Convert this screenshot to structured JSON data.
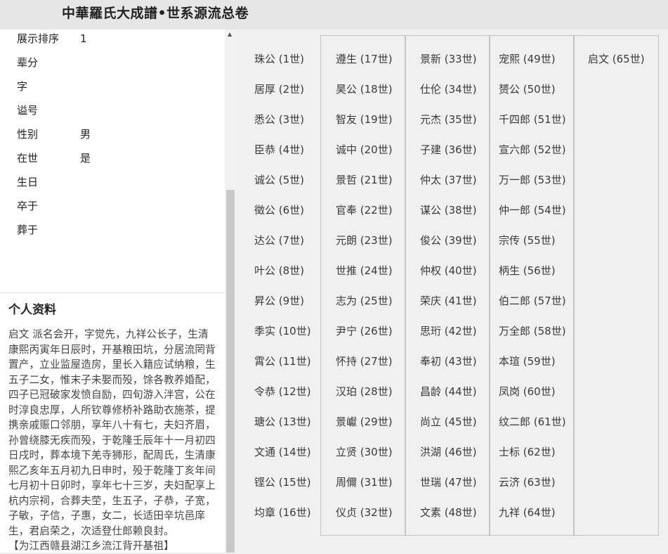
{
  "header": {
    "title": "中華羅氏大成譜•世系源流总卷"
  },
  "profile": {
    "rows": [
      {
        "label": "展示排序",
        "value": "1"
      },
      {
        "label": "辈分",
        "value": ""
      },
      {
        "label": "字",
        "value": ""
      },
      {
        "label": "谥号",
        "value": ""
      },
      {
        "label": "性别",
        "value": "男"
      },
      {
        "label": "在世",
        "value": "是"
      },
      {
        "label": "生日",
        "value": ""
      },
      {
        "label": "卒于",
        "value": ""
      },
      {
        "label": "葬于",
        "value": ""
      }
    ],
    "section_title": "个人资料",
    "bio": "启文 派名会开，字觉先，九祥公长子，生清康熙丙寅年日辰时，开基粮田坑，分居流罔背置产，立业监屋造房，里长入籍应试纳粮，生五子二女，惟末子未娶而殁，馀各教养婚配，四子已冠破家发愤自励，四旬游入泮宫，公在时淳良忠厚，人所钦尊修桥补路助衣施茶，提携亲戚赈口邻朋，享年八十有七，夫妇齐眉，孙曾绕膝无疾而殁，于乾隆壬辰年十一月初四日戌时，葬本境下羌寺狮形，配周氏，生清康熙乙亥年五月初九日申时，殁于乾隆丁亥年间七月初十日卯时，享年七十三岁，夫妇配享上杭内宗祠，合葬夫茔，生五子，子恭，子宽，子敏，子信，子惠，女二，长适田辛坑邑庠生，君启荣之，次适登仕郎赖良封。",
    "bio_last": "【为江西赣县湖江乡流江背开基祖】"
  },
  "generations": [
    "珠公 (1世)",
    "居厚 (2世)",
    "悉公 (3世)",
    "臣恭 (4世)",
    "诚公 (5世)",
    "徵公 (6世)",
    "达公 (7世)",
    "叶公 (8世)",
    "昇公 (9世)",
    "季实 (10世)",
    "霄公 (11世)",
    "令恭 (12世)",
    "瑭公 (13世)",
    "文通 (14世)",
    "铿公 (15世)",
    "均章 (16世)",
    "遵生 (17世)",
    "昊公 (18世)",
    "智友 (19世)",
    "诚中 (20世)",
    "景哲 (21世)",
    "官奉 (22世)",
    "元朗 (23世)",
    "世推 (24世)",
    "志为 (25世)",
    "尹宁 (26世)",
    "怀持 (27世)",
    "汉珀 (28世)",
    "景巘 (29世)",
    "立贤 (30世)",
    "周儞 (31世)",
    "仪贞 (32世)",
    "景新 (33世)",
    "仕伦 (34世)",
    "元杰 (35世)",
    "子建 (36世)",
    "仲太 (37世)",
    "谋公 (38世)",
    "俊公 (39世)",
    "仲权 (40世)",
    "荣庆 (41世)",
    "思珩 (42世)",
    "奉初 (43世)",
    "昌龄 (44世)",
    "尚立 (45世)",
    "洪湖 (46世)",
    "世瑞 (47世)",
    "文素 (48世)",
    "宠熙 (49世)",
    "赟公 (50世)",
    "千四郎 (51世)",
    "宣六郎 (52世)",
    "万一郎 (53世)",
    "仲一郎 (54世)",
    "宗传 (55世)",
    "柄生 (56世)",
    "伯二郎 (57世)",
    "万全郎 (58世)",
    "本瑄 (59世)",
    "凤岗 (60世)",
    "纹二郎 (61世)",
    "士标 (62世)",
    "云济 (63世)",
    "九祥 (64世)",
    "启文 (65世)"
  ]
}
